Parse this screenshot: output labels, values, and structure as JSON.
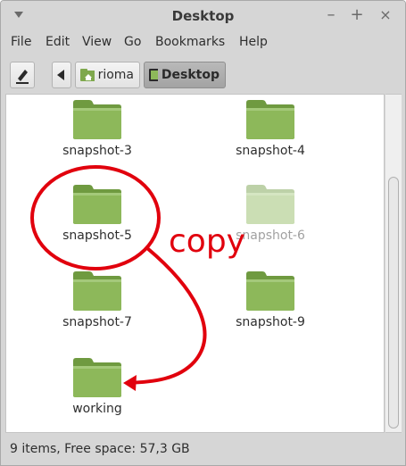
{
  "window": {
    "title": "Desktop",
    "controls": {
      "minimize": "–",
      "maximize": "+",
      "close": "×"
    }
  },
  "menu": [
    "File",
    "Edit",
    "View",
    "Go",
    "Bookmarks",
    "Help"
  ],
  "toolbar": {
    "breadcrumbs": [
      {
        "label": "rioma",
        "icon": "home-folder-icon"
      },
      {
        "label": "Desktop",
        "icon": "desktop-icon",
        "active": true
      }
    ]
  },
  "files": [
    {
      "name": "snapshot-3",
      "icon": "folder-icon"
    },
    {
      "name": "snapshot-4",
      "icon": "folder-icon"
    },
    {
      "name": "snapshot-5",
      "icon": "folder-icon"
    },
    {
      "name": "snapshot-6",
      "icon": "folder-icon",
      "dimmed": true
    },
    {
      "name": "snapshot-7",
      "icon": "folder-icon"
    },
    {
      "name": "snapshot-9",
      "icon": "folder-icon"
    },
    {
      "name": "working",
      "icon": "folder-icon"
    }
  ],
  "status": "9 items, Free space: 57,3 GB",
  "annotation": {
    "text": "copy",
    "color": "#e1000d"
  },
  "colors": {
    "folder": "#8db85a",
    "folder_dark": "#6f9a40",
    "accent": "#e1000d"
  }
}
